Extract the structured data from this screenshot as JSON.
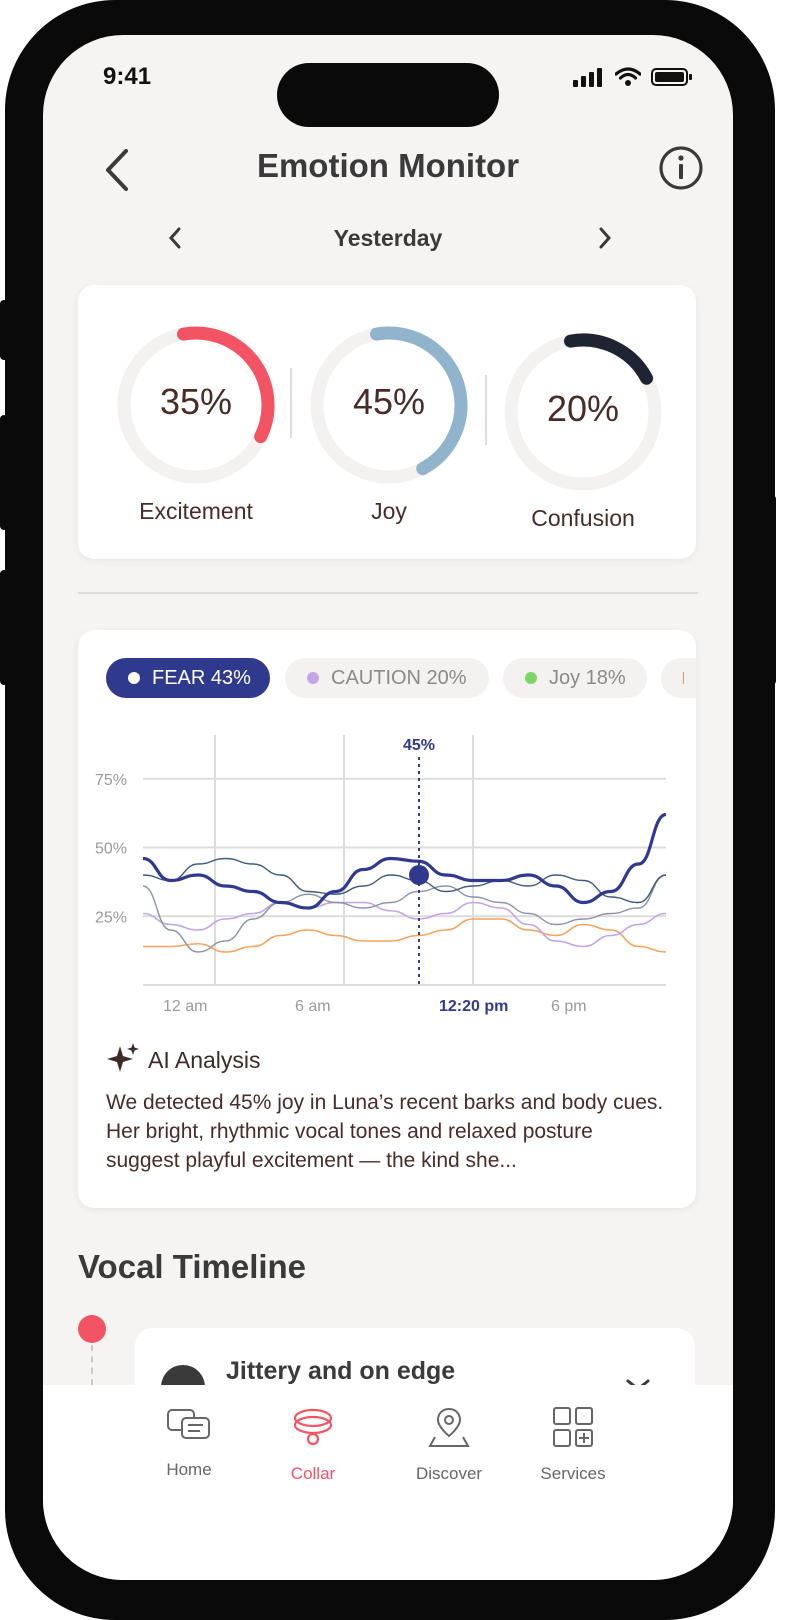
{
  "status": {
    "time": "9:41"
  },
  "header": {
    "title": "Emotion Monitor"
  },
  "date": {
    "label": "Yesterday"
  },
  "rings": [
    {
      "value": "35%",
      "label": "Excitement",
      "color": "#f25464",
      "fraction": 0.35
    },
    {
      "value": "45%",
      "label": "Joy",
      "color": "#8fb4cc",
      "fraction": 0.45
    },
    {
      "value": "20%",
      "label": "Confusion",
      "color": "#1f2433",
      "fraction": 0.2
    }
  ],
  "chips": [
    {
      "label": "FEAR 43%",
      "color": "#ffffff",
      "active": true
    },
    {
      "label": "CAUTION 20%",
      "color": "#c4a4e6",
      "active": false
    },
    {
      "label": "Joy 18%",
      "color": "#7ed56a",
      "active": false
    },
    {
      "label": "",
      "color": "#f4924d",
      "active": false
    }
  ],
  "chart_data": {
    "type": "line",
    "x": [
      "12 am",
      "6 am",
      "12:20 pm",
      "6 pm"
    ],
    "y_ticks": [
      "75%",
      "50%",
      "25%"
    ],
    "ylim": [
      0,
      100
    ],
    "highlight": {
      "label": "45%",
      "x": "12:20 pm"
    },
    "series": [
      {
        "values": [
          46,
          38,
          40,
          36,
          34,
          30,
          28,
          34,
          42,
          46,
          45,
          40,
          38,
          38,
          40,
          36,
          30,
          34,
          44,
          62
        ]
      },
      {
        "values": [
          40,
          38,
          44,
          46,
          44,
          40,
          34,
          33,
          36,
          40,
          38,
          34,
          36,
          38,
          36,
          40,
          38,
          32,
          30,
          40
        ]
      },
      {
        "values": [
          36,
          20,
          12,
          16,
          24,
          30,
          33,
          30,
          28,
          30,
          34,
          36,
          32,
          30,
          26,
          22,
          24,
          26,
          28,
          40
        ]
      },
      {
        "values": [
          26,
          22,
          20,
          24,
          26,
          30,
          28,
          30,
          30,
          27,
          24,
          26,
          30,
          28,
          22,
          16,
          14,
          18,
          22,
          26
        ]
      },
      {
        "values": [
          14,
          14,
          15,
          12,
          14,
          18,
          20,
          18,
          16,
          16,
          18,
          20,
          24,
          24,
          20,
          18,
          22,
          20,
          14,
          12
        ]
      }
    ]
  },
  "ai": {
    "title": "AI Analysis",
    "text": "We detected 45% joy in Luna’s recent barks and body cues. Her bright, rhythmic vocal tones and relaxed posture suggest playful excitement — the kind she..."
  },
  "timeline": {
    "section_title": "Vocal Timeline",
    "item_title": "Jittery and on edge"
  },
  "tabs": [
    {
      "label": "Home",
      "icon": "home-chat-icon"
    },
    {
      "label": "Collar",
      "icon": "collar-icon"
    },
    {
      "label": "Discover",
      "icon": "map-pin-icon"
    },
    {
      "label": "Services",
      "icon": "grid-plus-icon"
    }
  ],
  "colors": {
    "accent": "#f25464",
    "primary": "#2f3a8f"
  }
}
